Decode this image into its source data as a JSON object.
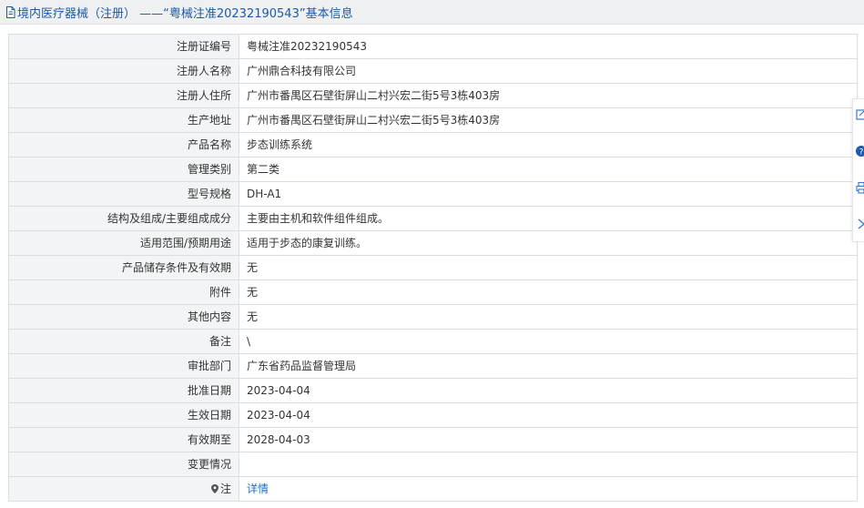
{
  "header": {
    "title": "境内医疗器械（注册） ——“粤械注准20232190543”基本信息",
    "icon": "document-icon"
  },
  "rows": [
    {
      "label": "注册证编号",
      "value": "粤械注准20232190543"
    },
    {
      "label": "注册人名称",
      "value": "广州鼎合科技有限公司"
    },
    {
      "label": "注册人住所",
      "value": "广州市番禺区石壁街屏山二村兴宏二街5号3栋403房"
    },
    {
      "label": "生产地址",
      "value": "广州市番禺区石壁街屏山二村兴宏二街5号3栋403房"
    },
    {
      "label": "产品名称",
      "value": "步态训练系统"
    },
    {
      "label": "管理类别",
      "value": "第二类"
    },
    {
      "label": "型号规格",
      "value": "DH-A1"
    },
    {
      "label": "结构及组成/主要组成成分",
      "value": "主要由主机和软件组件组成。"
    },
    {
      "label": "适用范围/预期用途",
      "value": "适用于步态的康复训练。"
    },
    {
      "label": "产品储存条件及有效期",
      "value": "无"
    },
    {
      "label": "附件",
      "value": "无"
    },
    {
      "label": "其他内容",
      "value": "无"
    },
    {
      "label": "备注",
      "value": "\\"
    },
    {
      "label": "审批部门",
      "value": "广东省药品监督管理局"
    },
    {
      "label": "批准日期",
      "value": "2023-04-04"
    },
    {
      "label": "生效日期",
      "value": "2023-04-04"
    },
    {
      "label": "有效期至",
      "value": "2028-04-03"
    },
    {
      "label": "变更情况",
      "value": ""
    }
  ],
  "note_row": {
    "label": "注",
    "link": "详情",
    "icon": "map-pin-icon"
  },
  "side_tools": [
    "edit-icon",
    "help-icon",
    "print-icon",
    "collapse-icon"
  ],
  "colors": {
    "title_text": "#1e5aa8",
    "link": "#1a6fd3",
    "label_bg": "#f3f4f6",
    "border": "#d9dee5"
  }
}
